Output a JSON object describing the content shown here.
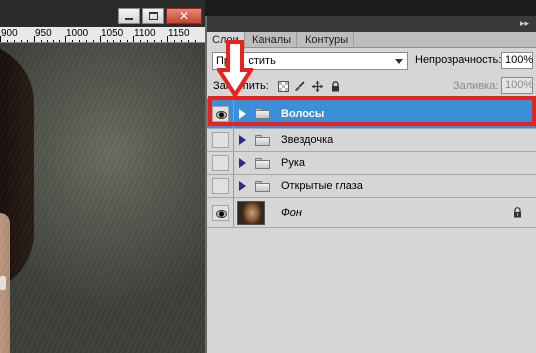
{
  "ruler": {
    "labels": [
      "900",
      "950",
      "1000",
      "1050",
      "1100",
      "1150"
    ]
  },
  "window_buttons": {
    "minimize_icon": "minimize-icon",
    "maximize_icon": "maximize-icon",
    "close_icon": "close-icon",
    "close_glyph": "✕"
  },
  "panel": {
    "tabs": [
      {
        "label": "Слои",
        "active": true
      },
      {
        "label": "Каналы",
        "active": false
      },
      {
        "label": "Контуры",
        "active": false
      }
    ],
    "blend_mode": "Пр      стить",
    "opacity_label": "Непрозрачность:",
    "opacity_value": "100%",
    "lock_label": "Закрепить:",
    "fill_label": "Заливка:",
    "fill_value": "100%",
    "layers": [
      {
        "name": "Волосы",
        "visible": true,
        "type": "group",
        "selected": true
      },
      {
        "name": "Звездочка",
        "visible": false,
        "type": "group",
        "selected": false
      },
      {
        "name": "Рука",
        "visible": false,
        "type": "group",
        "selected": false
      },
      {
        "name": "Открытые глаза",
        "visible": false,
        "type": "group",
        "selected": false
      },
      {
        "name": "Фон",
        "visible": true,
        "type": "background",
        "selected": false,
        "locked": true
      }
    ]
  },
  "colors": {
    "selection": "#3c8ed9",
    "annotation": "#e8221c"
  }
}
